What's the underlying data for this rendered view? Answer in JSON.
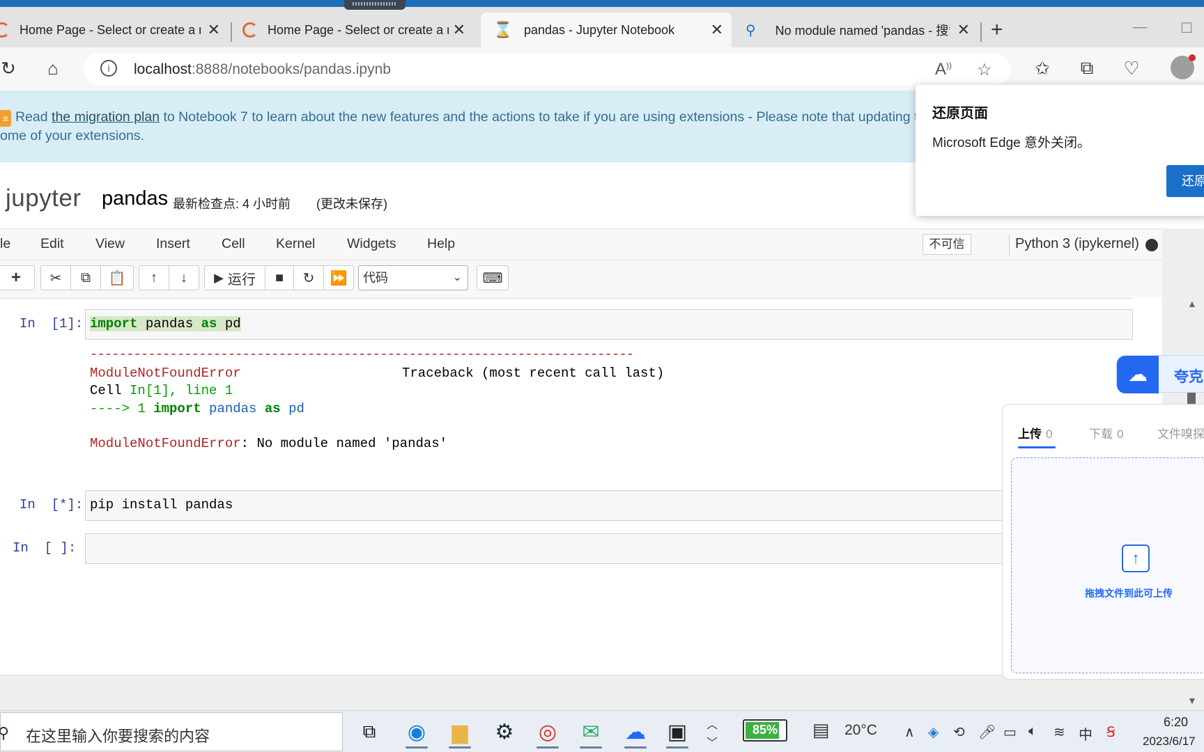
{
  "browser": {
    "tabs": [
      {
        "title": "Home Page - Select or create a n",
        "icon": "jupyter-spinner-icon"
      },
      {
        "title": "Home Page - Select or create a n",
        "icon": "jupyter-spinner-icon"
      },
      {
        "title": "pandas - Jupyter Notebook",
        "icon": "hourglass-icon",
        "active": true
      },
      {
        "title": "No module named 'pandas - 搜索",
        "icon": "search-icon"
      }
    ],
    "new_tab": "+",
    "url_host": "localhost",
    "url_rest": ":8888/notebooks/pandas.ipynb"
  },
  "banner": {
    "prefix": "Read",
    "link": "the migration plan",
    "line1_rest": "to Notebook 7 to learn about the new features and the actions to take if you are using extensions - Please note that updating t",
    "line2": "ome of your extensions."
  },
  "notebook": {
    "logo": "jupyter",
    "name": "pandas",
    "checkpoint": "最新检查点: 4 小时前",
    "unsaved": "(更改未保存)"
  },
  "menu": [
    "le",
    "Edit",
    "View",
    "Insert",
    "Cell",
    "Kernel",
    "Widgets",
    "Help"
  ],
  "trust": "不可信",
  "kernel": "Python 3 (ipykernel)",
  "toolbar": {
    "run_label": "运行",
    "cell_type": "代码"
  },
  "cells": [
    {
      "prompt": "In  [1]:",
      "code_kw": "import",
      "code_mid": " pandas ",
      "code_kw2": "as",
      "code_end": " pd"
    },
    {
      "prompt": "In  [*]:",
      "code": "pip install pandas"
    },
    {
      "prompt": "In  [ ]:",
      "code": ""
    }
  ],
  "traceback": {
    "dashes": "---------------------------------------------------------------------------",
    "error_name": "ModuleNotFoundError",
    "tb_header": "Traceback (most recent call last)",
    "cell_line_prefix": "Cell ",
    "cell_ref": "In[1], line 1",
    "arrow": "----> 1 ",
    "arrow_kw": "import",
    "arrow_mid": " pandas ",
    "arrow_kw2": "as",
    "arrow_end": " pd",
    "final_name": "ModuleNotFoundError",
    "final_msg": ": No module named 'pandas'"
  },
  "restore_popup": {
    "title": "还原页面",
    "message": "Microsoft Edge 意外关闭。",
    "button": "还原"
  },
  "quark": {
    "name": "夸克",
    "tabs": [
      {
        "label": "上传",
        "count": "0"
      },
      {
        "label": "下载",
        "count": "0"
      },
      {
        "label": "文件嗅探"
      }
    ],
    "drop_text": "拖拽文件到此可上传"
  },
  "taskbar": {
    "search_placeholder": "在这里输入你要搜索的内容",
    "battery": "85%",
    "battery_level": 0.85,
    "weather": "20°C",
    "ime": "中",
    "time": "6:20",
    "date": "2023/6/17"
  }
}
